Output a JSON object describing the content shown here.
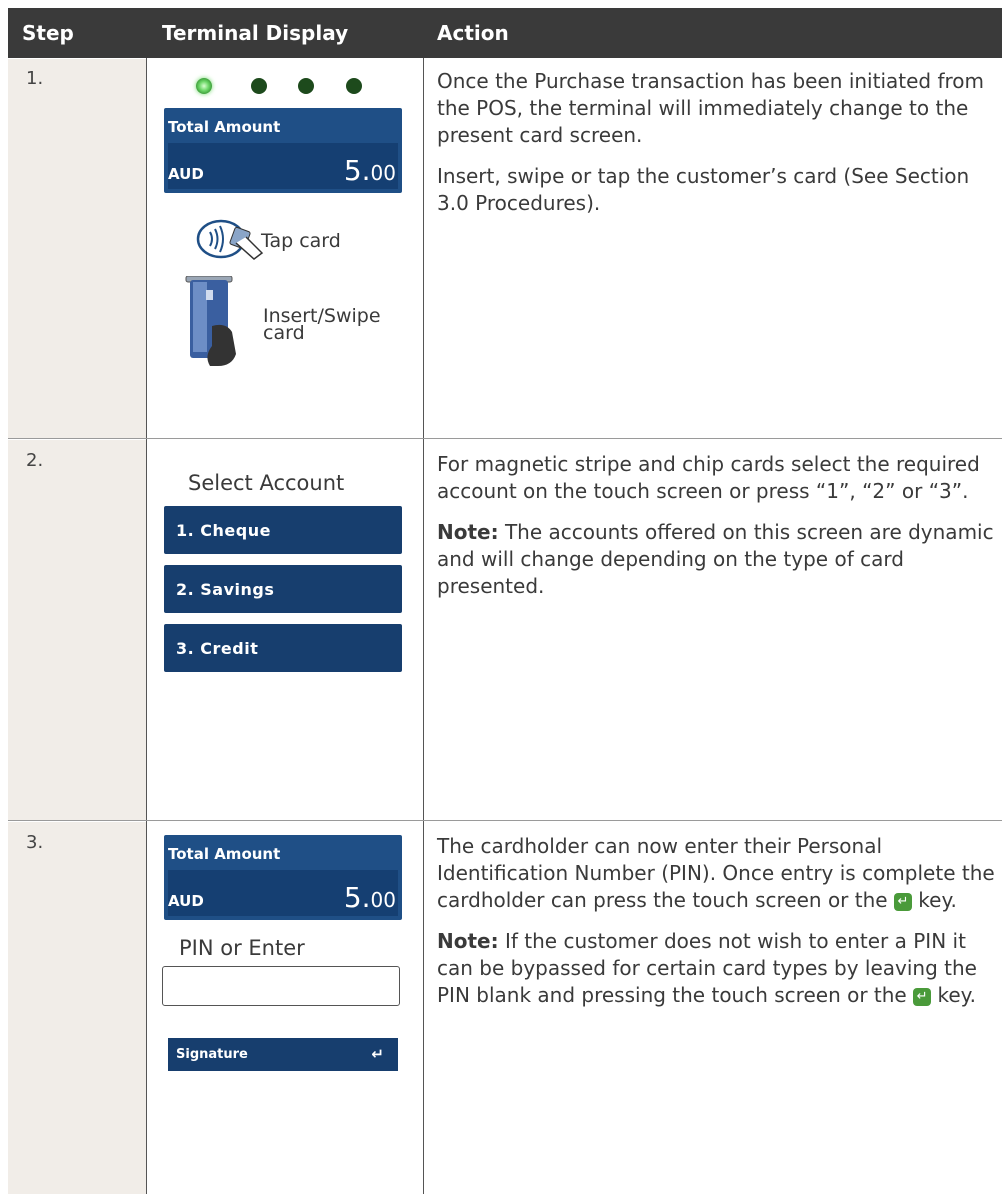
{
  "header": {
    "col_step": "Step",
    "col_display": "Terminal Display",
    "col_action": "Action"
  },
  "rows": [
    {
      "step": "1.",
      "display": {
        "amount_title": "Total Amount",
        "currency": "AUD",
        "amount_main": "5.",
        "amount_cents": "00",
        "tap_label": "Tap card",
        "insert_label": "Insert/Swipe card"
      },
      "action": {
        "p1": "Once the Purchase transaction has been initiated from the POS, the terminal will immediately change to the present card screen.",
        "p2": "Insert, swipe or tap the customer’s card (See Section 3.0 Procedures)."
      }
    },
    {
      "step": "2.",
      "display": {
        "title": "Select Account",
        "options": [
          "1. Cheque",
          "2. Savings",
          "3. Credit"
        ]
      },
      "action": {
        "p1": "For magnetic stripe and chip cards select the required account on the touch screen or press “1”, “2” or “3”.",
        "note_label": "Note:",
        "p2": "The accounts offered on this screen are dynamic and will change depending on the type of card presented."
      }
    },
    {
      "step": "3.",
      "display": {
        "amount_title": "Total Amount",
        "currency": "AUD",
        "amount_main": "5.",
        "amount_cents": "00",
        "pin_label": "PIN or Enter",
        "signature_label": "Signature"
      },
      "action": {
        "p1_a": "The cardholder can now enter their Personal Identification Number (PIN). Once entry is complete the cardholder can press the touch screen or the",
        "p1_b": "key.",
        "note_label": "Note:",
        "p2_a": "If the customer does not wish to enter a PIN it can be bypassed for certain card types by leaving the PIN blank and pressing the touch screen or the",
        "p2_b": "key."
      }
    }
  ],
  "colors": {
    "header_bg": "#3a3a3a",
    "panel_blue": "#1f4f86",
    "button_blue": "#173e6e",
    "led_green": "#6fd86a",
    "enter_green": "#4a9a3a"
  }
}
